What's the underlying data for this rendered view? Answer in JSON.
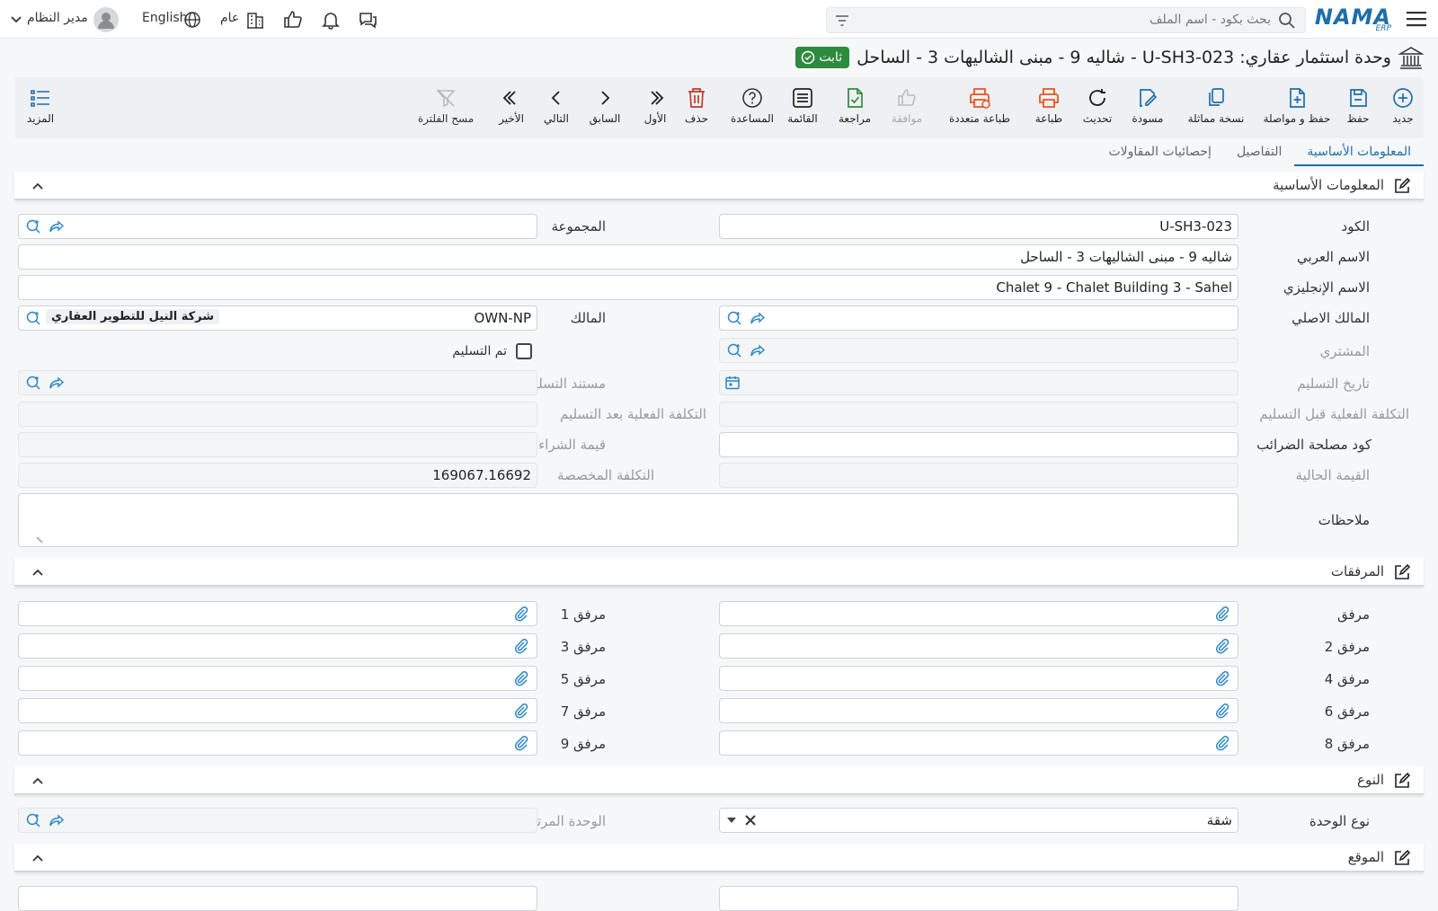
{
  "topbar": {
    "search_placeholder": "بحث بكود - اسم الملف",
    "user_name": "مدير النظام",
    "language": "English",
    "branch": "عام",
    "logo_text": "NAMA",
    "logo_sub": "ERP"
  },
  "page": {
    "title": "وحدة استثمار عقاري: U-SH3-023 - شاليه 9 - مبنى الشاليهات 3 - الساحل",
    "status_badge": "ثابت"
  },
  "toolbar": {
    "new": "جديد",
    "save": "حفظ",
    "save_continue": "حفظ و مواصلة",
    "duplicate": "نسخة مماثلة",
    "draft": "مسودة",
    "refresh": "تحديث",
    "print": "طباعة",
    "multi_print": "طباعة متعددة",
    "approve": "موافقة",
    "review": "مراجعة",
    "list": "القائمة",
    "help": "المساعدة",
    "delete": "حذف",
    "first": "الأول",
    "previous": "السابق",
    "next": "التالي",
    "last": "الأخير",
    "clear_filter": "مسح الفلترة",
    "more": "المزيد"
  },
  "tabs": [
    "المعلومات الأساسية",
    "التفاصيل",
    "إحصائيات المقاولات"
  ],
  "sections": {
    "basic": "المعلومات الأساسية",
    "attachments": "المرفقات",
    "type": "النوع",
    "location": "الموقع"
  },
  "form": {
    "code_label": "الكود",
    "code_value": "U-SH3-023",
    "group_label": "المجموعة",
    "arabic_name_label": "الاسم العربي",
    "arabic_name_value": "شاليه 9 - مبنى الشاليهات 3 - الساحل",
    "english_name_label": "الاسم الإنجليزي",
    "english_name_value": "Chalet 9 - Chalet Building 3 - Sahel",
    "original_owner_label": "المالك الاصلي",
    "owner_label": "المالك",
    "owner_code": "OWN-NP",
    "owner_name": "شركة النيل للتطوير العقاري",
    "buyer_label": "المشتري",
    "delivered_label": "تم التسليم",
    "delivery_date_label": "تاريخ التسليم",
    "delivery_doc_label": "مستند التسليم",
    "cost_before_label": "التكلفة الفعلية قبل التسليم",
    "cost_after_label": "التكلفة الفعلية بعد التسليم",
    "tax_code_label": "كود مصلحة الضرائب",
    "purchase_value_label": "قيمة الشراء",
    "current_value_label": "القيمة الحالية",
    "allocated_cost_label": "التكلفة المخصصة",
    "allocated_cost_value": "169067.16692",
    "notes_label": "ملاحظات"
  },
  "attachments": {
    "a0": "مرفق",
    "a1": "مرفق 1",
    "a2": "مرفق 2",
    "a3": "مرفق 3",
    "a4": "مرفق 4",
    "a5": "مرفق 5",
    "a6": "مرفق 6",
    "a7": "مرفق 7",
    "a8": "مرفق 8",
    "a9": "مرفق 9"
  },
  "type_section": {
    "unit_type_label": "نوع الوحدة",
    "unit_type_value": "شقة",
    "linked_unit_label": "الوحدة المرتبطة"
  },
  "icons": {
    "accent": "#1f6ea8",
    "print_color": "#e8541f",
    "delete_color": "#c0392b",
    "review_color": "#2e8b3e",
    "badge_color": "#2e8b3e"
  }
}
